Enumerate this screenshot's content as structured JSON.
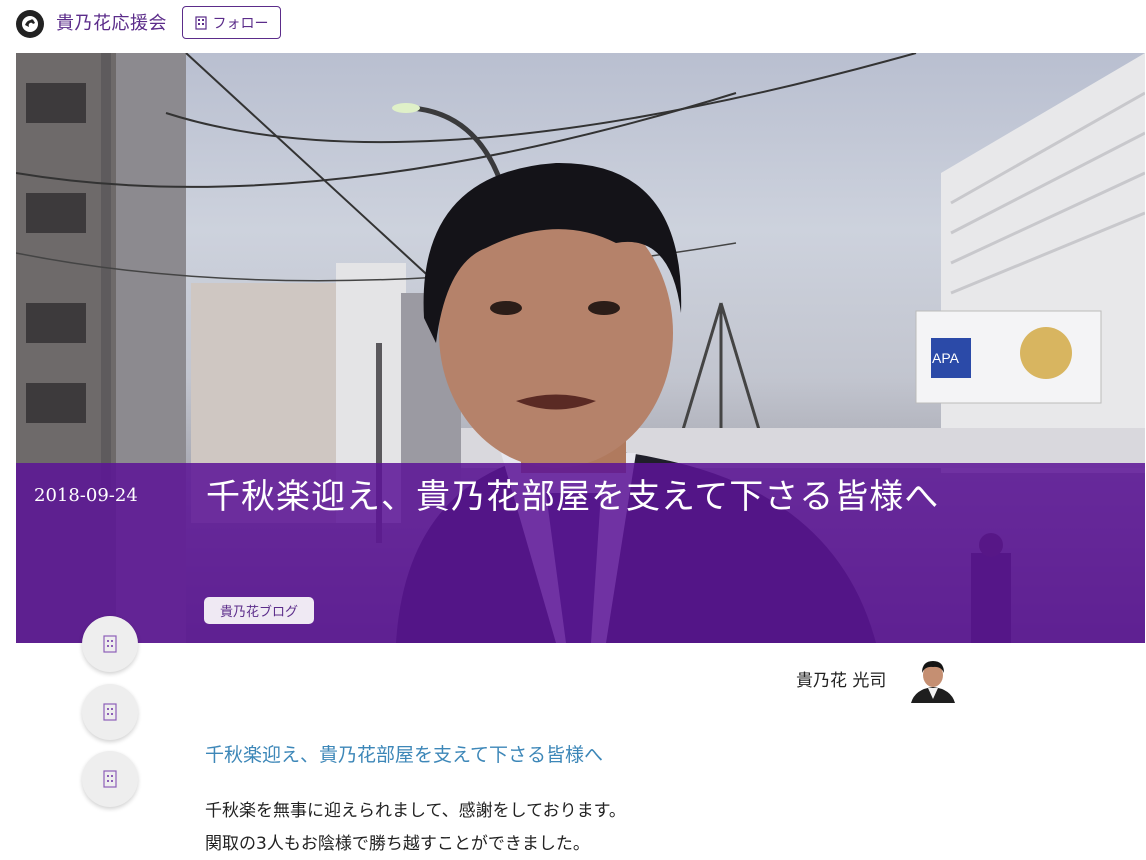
{
  "header": {
    "site_name": "貴乃花応援会",
    "follow_label": "フォロー",
    "logo_icon": "sumo-wrestler-logo-icon",
    "accent_color": "#5b2c8a"
  },
  "hero": {
    "date": "2018-09-24",
    "title": "千秋楽迎え、貴乃花部屋を支えて下さる皆様へ",
    "category": "貴乃花ブログ",
    "band_color": "#5c1496",
    "photo_sign_text": "APA"
  },
  "share_buttons": [
    {
      "icon": "share-icon"
    },
    {
      "icon": "share-icon"
    },
    {
      "icon": "share-icon"
    }
  ],
  "author": {
    "name": "貴乃花 光司"
  },
  "article": {
    "subtitle": "千秋楽迎え、貴乃花部屋を支えて下さる皆様へ",
    "subtitle_color": "#3d87b8",
    "paragraphs": [
      "千秋楽を無事に迎えられまして、感謝をしております。",
      "関取の3人もお陰様で勝ち越すことができました。"
    ]
  }
}
